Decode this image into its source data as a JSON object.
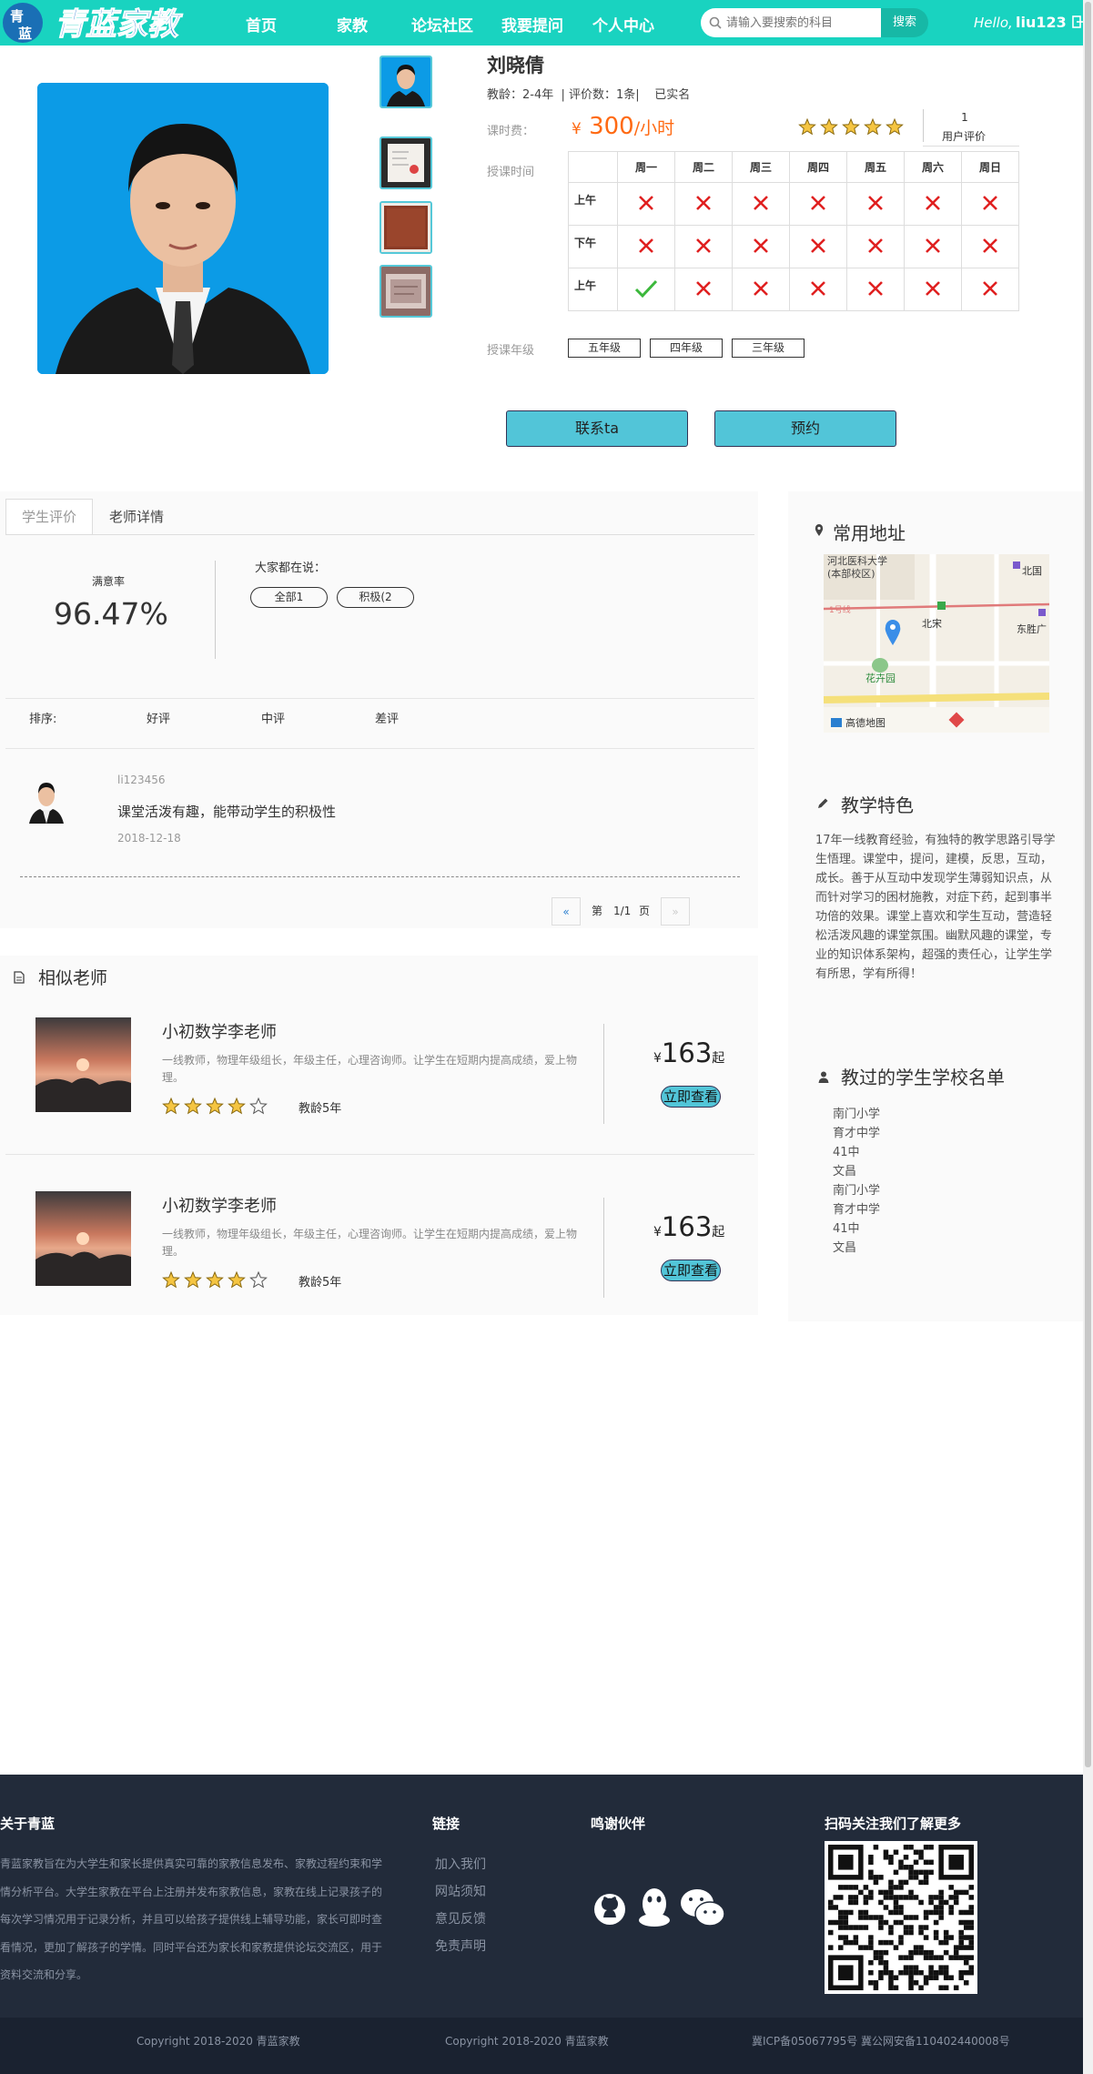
{
  "header": {
    "logo_text": "青蓝家教",
    "nav": [
      "首页",
      "家教",
      "论坛社区",
      "我要提问",
      "个人中心"
    ],
    "search_placeholder": "请输入要搜索的科目",
    "search_button": "搜索",
    "hello": "Hello,",
    "username": "liu123"
  },
  "teacher": {
    "name": "刘晓倩",
    "meta": "教龄：2-4年  | 评价数：1条|    已实名",
    "fee_label": "课时费：",
    "price_yen": "¥",
    "price": "300",
    "price_unit": "/小时",
    "rating_stars": 5,
    "rating_count": "1",
    "rating_label": "用户评价",
    "schedule_label": "授课时间",
    "days": [
      "周一",
      "周二",
      "周三",
      "周四",
      "周五",
      "周六",
      "周日"
    ],
    "rows": [
      {
        "label": "上午",
        "slots": [
          false,
          false,
          false,
          false,
          false,
          false,
          false
        ]
      },
      {
        "label": "下午",
        "slots": [
          false,
          false,
          false,
          false,
          false,
          false,
          false
        ]
      },
      {
        "label": "上午",
        "slots": [
          true,
          false,
          false,
          false,
          false,
          false,
          false
        ]
      }
    ],
    "grade_label": "授课年级",
    "grades": [
      "五年级",
      "四年级",
      "三年级"
    ],
    "contact_button": "联系ta",
    "book_button": "预约"
  },
  "reviews": {
    "tabs": [
      "学生评价",
      "老师详情"
    ],
    "satisfaction_label": "满意率",
    "satisfaction": "96.47%",
    "say_label": "大家都在说：",
    "pills": [
      "全部1",
      "积极(2"
    ],
    "sort_label": "排序:",
    "sort_options": [
      "好评",
      "中评",
      "差评"
    ],
    "items": [
      {
        "user": "li123456",
        "text": "课堂活泼有趣，能带动学生的积极性",
        "date": "2018-12-18"
      }
    ],
    "pager": {
      "prev": "«",
      "page_prefix": "第",
      "page": "1/1",
      "page_suffix": "页",
      "next": "»"
    }
  },
  "similar": {
    "title": "相似老师",
    "cards": [
      {
        "name": "小初数学李老师",
        "desc": "一线教师，物理年级组长，年级主任，心理咨询师。让学生在短期内提高成绩，爱上物理。",
        "stars": 4,
        "years": "教龄5年",
        "yen": "¥",
        "price": "163",
        "suffix": "起",
        "button": "立即查看"
      },
      {
        "name": "小初数学李老师",
        "desc": "一线教师，物理年级组长，年级主任，心理咨询师。让学生在短期内提高成绩，爱上物理。",
        "stars": 4,
        "years": "教龄5年",
        "yen": "¥",
        "price": "163",
        "suffix": "起",
        "button": "立即查看"
      }
    ]
  },
  "sidebar": {
    "address_title": "常用地址",
    "map_labels": [
      "河北医科大学",
      "(本部校区)",
      "北国",
      "北宋",
      "东胜广",
      "花卉园",
      "高德地图",
      "1号线"
    ],
    "features_title": "教学特色",
    "features_text": "17年一线教育经验，有独特的教学思路引导学生悟理。课堂中，提问，建模，反思，互动，成长。善于从互动中发现学生薄弱知识点，从而针对学习的困材施教，对症下药，起到事半功倍的效果。课堂上喜欢和学生互动，营造轻松活泼风趣的课堂氛围。幽默风趣的课堂，专业的知识体系架构，超强的责任心，让学生学有所思，学有所得！",
    "schools_title": "教过的学生学校名单",
    "schools": [
      "南门小学",
      "育才中学",
      "41中",
      "文昌",
      "南门小学",
      "育才中学",
      "41中",
      "文昌"
    ]
  },
  "footer": {
    "about_title": "关于青蓝",
    "about_text": "青蓝家教旨在为大学生和家长提供真实可靠的家教信息发布、家教过程约束和学情分析平台。大学生家教在平台上注册并发布家教信息，家教在线上记录孩子的每次学习情况用于记录分析，并且可以给孩子提供线上辅导功能，家长可即时查看情况，更加了解孩子的学情。同时平台还为家长和家教提供论坛交流区，用于资料交流和分享。",
    "links_title": "链接",
    "links": [
      "加入我们",
      "网站须知",
      "意见反馈",
      "免责声明"
    ],
    "partners_title": "鸣谢伙伴",
    "qr_title": "扫码关注我们了解更多",
    "copy1": "Copyright 2018-2020   青蓝家教",
    "copy2": "Copyright 2018-2020   青蓝家教",
    "icp": "冀ICP备05067795号 冀公网安备110402440008号"
  },
  "colors": {
    "header": "#19d3c0",
    "accent_button": "#52c5d8",
    "price": "#ff6a13",
    "footer": "#222b3a"
  }
}
